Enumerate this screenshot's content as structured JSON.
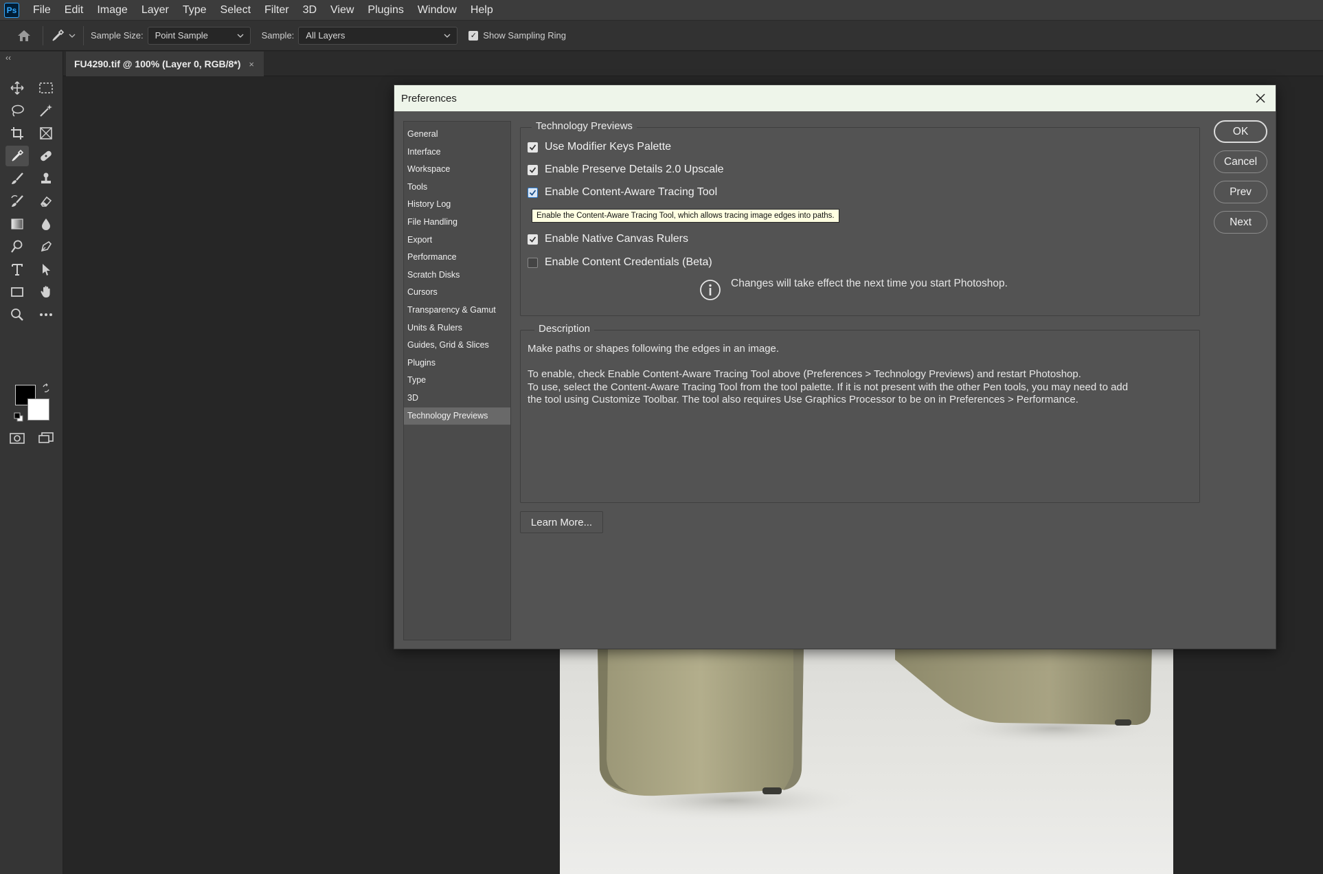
{
  "app": {
    "logo": "Ps",
    "menu": [
      "File",
      "Edit",
      "Image",
      "Layer",
      "Type",
      "Select",
      "Filter",
      "3D",
      "View",
      "Plugins",
      "Window",
      "Help"
    ]
  },
  "options_bar": {
    "sample_size_label": "Sample Size:",
    "sample_size_value": "Point Sample",
    "sample_label": "Sample:",
    "sample_value": "All Layers",
    "show_sampling_ring_label": "Show Sampling Ring",
    "show_sampling_ring_checked": true
  },
  "document_tab": {
    "title": "FU4290.tif @ 100% (Layer 0, RGB/8*)",
    "close_glyph": "×"
  },
  "collapse_glyph": "‹‹",
  "tools": [
    "move-tool-icon",
    "rectangular-marquee-icon",
    "lasso-icon",
    "magic-wand-icon",
    "crop-icon",
    "frame-icon",
    "eyedropper-icon",
    "healing-brush-icon",
    "brush-icon",
    "clone-stamp-icon",
    "history-brush-icon",
    "eraser-icon",
    "gradient-icon",
    "blur-icon",
    "dodge-icon",
    "pen-icon",
    "type-icon",
    "path-selection-icon",
    "rectangle-icon",
    "hand-icon",
    "zoom-icon",
    "more-tools-icon",
    "quick-mask-icon",
    "screen-mode-icon"
  ],
  "dialog": {
    "title": "Preferences",
    "nav": [
      "General",
      "Interface",
      "Workspace",
      "Tools",
      "History Log",
      "File Handling",
      "Export",
      "Performance",
      "Scratch Disks",
      "Cursors",
      "Transparency & Gamut",
      "Units & Rulers",
      "Guides, Grid & Slices",
      "Plugins",
      "Type",
      "3D",
      "Technology Previews"
    ],
    "selected_nav": "Technology Previews",
    "tech_previews": {
      "title": "Technology Previews",
      "options": [
        {
          "label": "Use Modifier Keys Palette",
          "checked": true
        },
        {
          "label": "Enable Preserve Details 2.0 Upscale",
          "checked": true
        },
        {
          "label": "Enable Content-Aware Tracing Tool",
          "checked": true
        },
        {
          "label": "Enable Native Canvas Rulers",
          "checked": true
        },
        {
          "label": "Enable Content Credentials (Beta)",
          "checked": false
        }
      ],
      "tooltip": "Enable the Content-Aware Tracing Tool, which allows tracing image edges into paths.",
      "info": "Changes will take effect the next time you start Photoshop."
    },
    "description": {
      "title": "Description",
      "line1": "Make paths or shapes following the edges in an image.",
      "line2": "To enable, check Enable Content-Aware Tracing Tool above (Preferences > Technology Previews) and restart Photoshop.",
      "line3": "To use, select the Content-Aware Tracing Tool from the tool palette.  If it is not present with the other Pen tools, you may need to add",
      "line4": "the tool using Customize Toolbar.  The tool also requires Use Graphics Processor to be on in Preferences > Performance."
    },
    "learn_more": "Learn More...",
    "buttons": {
      "ok": "OK",
      "cancel": "Cancel",
      "prev": "Prev",
      "next": "Next"
    }
  }
}
